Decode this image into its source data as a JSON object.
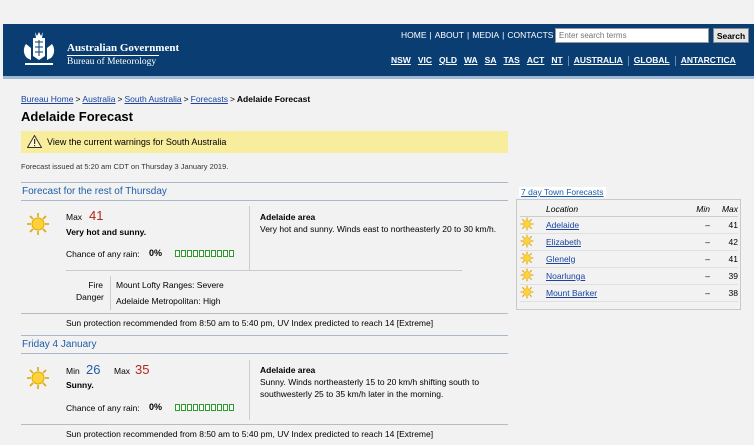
{
  "header": {
    "gov_title": "Australian Government",
    "bom_title": "Bureau of Meteorology",
    "top_links": [
      "HOME",
      "ABOUT",
      "MEDIA",
      "CONTACTS"
    ],
    "search_placeholder": "Enter search terms",
    "search_button": "Search",
    "state_links": [
      "NSW",
      "VIC",
      "QLD",
      "WA",
      "SA",
      "TAS",
      "ACT",
      "NT",
      "AUSTRALIA",
      "GLOBAL",
      "ANTARCTICA"
    ]
  },
  "breadcrumb": {
    "items": [
      "Bureau Home",
      "Australia",
      "South Australia",
      "Forecasts"
    ],
    "current": "Adelaide Forecast"
  },
  "page_title": "Adelaide Forecast",
  "warning": "View the current warnings for South Australia",
  "issued": "Forecast issued at 5:20 am CDT on Thursday 3 January 2019.",
  "forecasts": [
    {
      "heading": "Forecast for the rest of Thursday",
      "max_label": "Max",
      "max": "41",
      "summary": "Very hot and sunny.",
      "rain_label": "Chance of any rain:",
      "rain": "0%",
      "area_title": "Adelaide area",
      "area_text": "Very hot and sunny. Winds east to northeasterly 20 to 30 km/h.",
      "fire_label_1": "Fire",
      "fire_label_2": "Danger",
      "fire_items": [
        "Mount Lofty Ranges: Severe",
        "Adelaide Metropolitan: High"
      ],
      "sun_protection": "Sun protection recommended from 8:50 am to 5:40 pm, UV Index predicted to reach 14 [Extreme]"
    },
    {
      "heading": "Friday 4 January",
      "min_label": "Min",
      "min": "26",
      "max_label": "Max",
      "max": "35",
      "summary": "Sunny.",
      "rain_label": "Chance of any rain:",
      "rain": "0%",
      "area_title": "Adelaide area",
      "area_text": "Sunny. Winds northeasterly 15 to 20 km/h shifting south to southwesterly 25 to 35 km/h later in the morning.",
      "sun_protection": "Sun protection recommended from 8:50 am to 5:40 pm, UV Index predicted to reach 14 [Extreme]"
    }
  ],
  "towns": {
    "title": "7 day Town Forecasts",
    "columns": [
      "Location",
      "Min",
      "Max"
    ],
    "rows": [
      {
        "name": "Adelaide",
        "min": "–",
        "max": "41"
      },
      {
        "name": "Elizabeth",
        "min": "–",
        "max": "42"
      },
      {
        "name": "Glenelg",
        "min": "–",
        "max": "41"
      },
      {
        "name": "Noarlunga",
        "min": "–",
        "max": "39"
      },
      {
        "name": "Mount Barker",
        "min": "–",
        "max": "38"
      }
    ]
  },
  "colors": {
    "header_bg": "#0a3e73",
    "link": "#1a44a0",
    "heading_blue": "#1d5ea8",
    "max_red": "#b3261e",
    "warning_bg": "#f8ed9c",
    "rain_green": "#2e9b2e"
  },
  "icons": {
    "weather": "sunny-icon",
    "warning": "warning-triangle-icon",
    "crest": "coat-of-arms-icon"
  }
}
